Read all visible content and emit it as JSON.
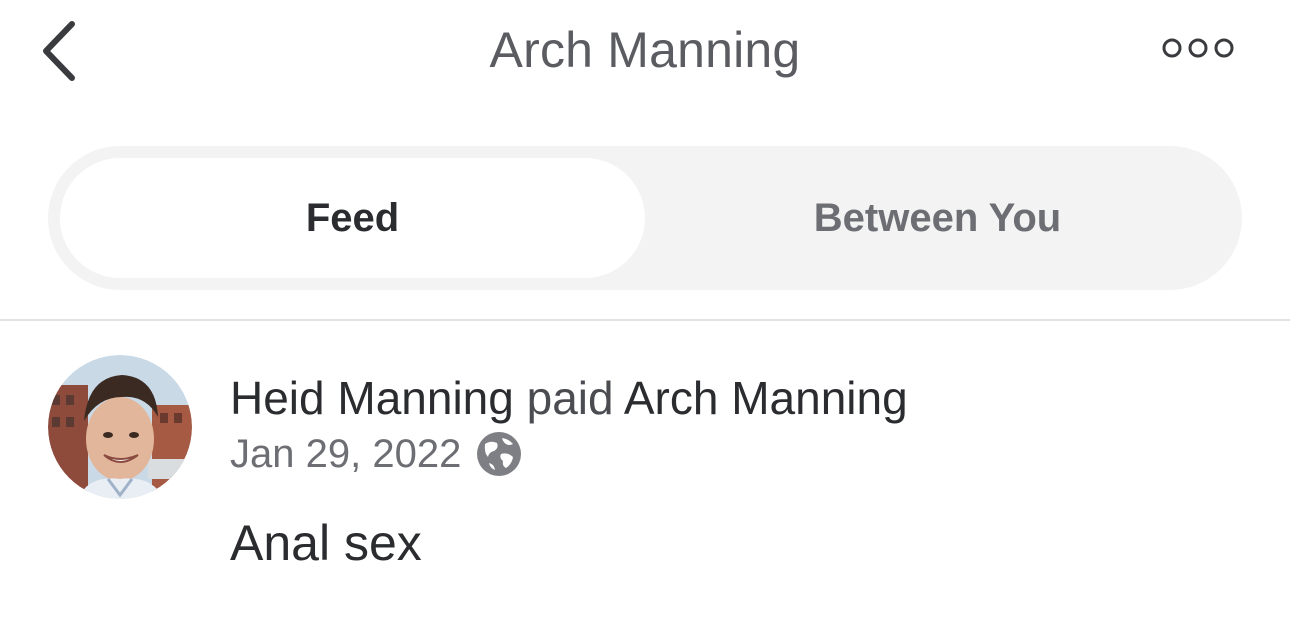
{
  "header": {
    "title": "Arch Manning",
    "back_icon": "chevron-left-icon",
    "more_icon": "more-options-icon"
  },
  "tabs": [
    {
      "label": "Feed",
      "active": true
    },
    {
      "label": "Between You",
      "active": false
    }
  ],
  "feed": {
    "items": [
      {
        "payer": "Heid Manning",
        "action": "paid",
        "payee": "Arch Manning",
        "date": "Jan 29, 2022",
        "privacy_icon": "globe-icon",
        "note": "Anal sex"
      }
    ]
  },
  "colors": {
    "segment_bg": "#f3f3f4",
    "text_dark": "#2b2c2f",
    "text_muted": "#6c6e73",
    "divider": "#e3e3e5"
  }
}
